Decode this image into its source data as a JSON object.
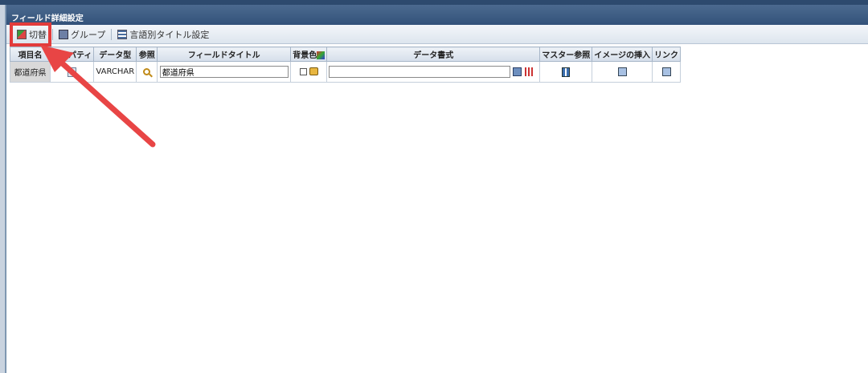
{
  "window": {
    "title": "フィールド詳細設定"
  },
  "toolbar": {
    "switch_label": "切替",
    "group_label": "グループ",
    "lang_title_label": "言語別タイトル設定"
  },
  "grid": {
    "headers": {
      "item_name": "項目名",
      "property": "プロパティ",
      "data_type": "データ型",
      "reference": "参照",
      "field_title": "フィールドタイトル",
      "bg_color": "背景色",
      "data_format": "データ書式",
      "master_ref": "マスター参照",
      "insert_image": "イメージの挿入",
      "link": "リンク"
    },
    "rows": [
      {
        "item_name": "都道府県",
        "data_type": "VARCHAR",
        "field_title": "都道府県",
        "data_format": ""
      }
    ]
  },
  "colors": {
    "titlebar": "#3e5d85",
    "highlight": "#e23b3b"
  }
}
